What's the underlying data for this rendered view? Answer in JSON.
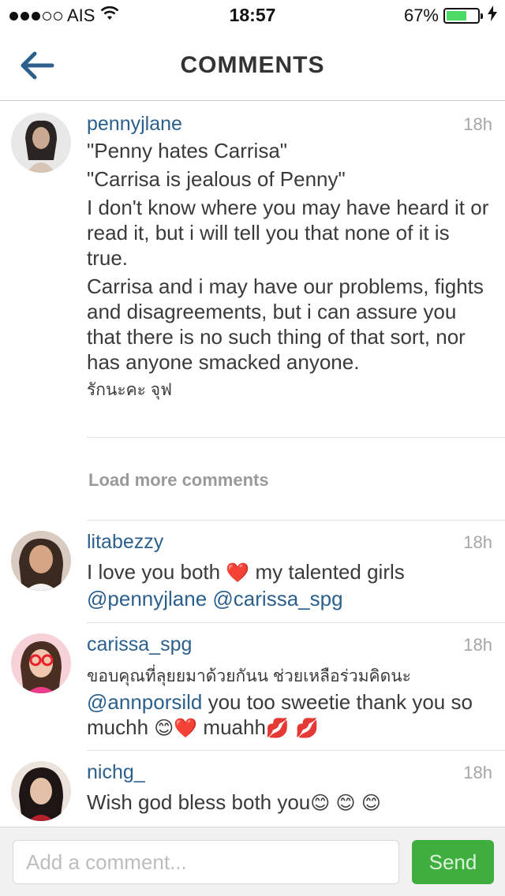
{
  "status_bar": {
    "carrier": "AIS",
    "time": "18:57",
    "battery_percent": "67%",
    "signal_bars_filled": 3,
    "signal_bars_total": 5,
    "battery_level": 0.67,
    "icons": [
      "wifi-icon",
      "battery-icon",
      "charging-icon"
    ]
  },
  "nav": {
    "title": "COMMENTS",
    "back_icon": "back-arrow-icon"
  },
  "comments": [
    {
      "username": "pennyjlane",
      "time": "18h",
      "paragraphs": [
        "\"Penny hates Carrisa\"",
        "\"Carrisa is jealous of Penny\"",
        "I don't know where you may have heard it or read it, but i will tell you that none of it is true.",
        "Carrisa and i may have our problems, fights and disagreements, but i can assure you that there is no such thing of that sort,  nor has anyone smacked anyone.",
        "รักนะคะ จุฟ"
      ]
    },
    {
      "username": "litabezzy",
      "time": "18h",
      "text_before": "I love you both ",
      "emoji_1": "❤️",
      "text_after": "  my talented girls",
      "mention_1": "@pennyjlane",
      "mention_2": "@carissa_spg"
    },
    {
      "username": "carissa_spg",
      "time": "18h",
      "line_thai": "ขอบคุณที่ลุยยมาด้วยกันน ช่วยเหลือร่วมคิดนะ",
      "mention": "@annporsild",
      "text_1": " you too sweetie thank you so muchh ",
      "emoji_1": "😊",
      "emoji_2": "❤️",
      "text_2": "  muahh",
      "emoji_3": "💋",
      "emoji_4": "💋"
    },
    {
      "username": "nichg_",
      "time": "18h",
      "text": "Wish god bless both you",
      "emoji_1": "😊",
      "emoji_2": "😊",
      "emoji_3": "😊"
    }
  ],
  "load_more": "Load more comments",
  "footer": {
    "input_placeholder": "Add a comment...",
    "send_label": "Send"
  },
  "colors": {
    "link": "#2b5f8c",
    "send_button": "#3fae3f",
    "battery_fill": "#4cd964",
    "timestamp": "#a6a6a6"
  }
}
